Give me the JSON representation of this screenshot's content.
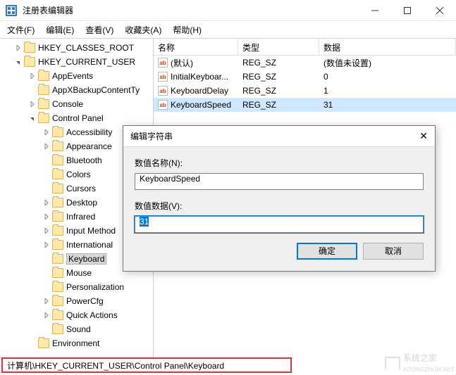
{
  "window": {
    "title": "注册表编辑器"
  },
  "menu": {
    "file": "文件(F)",
    "edit": "编辑(E)",
    "view": "查看(V)",
    "favorites": "收藏夹(A)",
    "help": "帮助(H)"
  },
  "tree": {
    "roots": [
      {
        "label": "HKEY_CLASSES_ROOT",
        "expanded": false,
        "indent": 20
      },
      {
        "label": "HKEY_CURRENT_USER",
        "expanded": true,
        "indent": 20
      }
    ],
    "hkcu_children": [
      {
        "label": "AppEvents",
        "indent": 40,
        "chev": true
      },
      {
        "label": "AppXBackupContentTy",
        "indent": 40,
        "chev": false
      },
      {
        "label": "Console",
        "indent": 40,
        "chev": true
      },
      {
        "label": "Control Panel",
        "indent": 40,
        "chev": true,
        "expanded": true
      }
    ],
    "cp_children": [
      {
        "label": "Accessibility",
        "indent": 60,
        "chev": true
      },
      {
        "label": "Appearance",
        "indent": 60,
        "chev": true
      },
      {
        "label": "Bluetooth",
        "indent": 60,
        "chev": false
      },
      {
        "label": "Colors",
        "indent": 60,
        "chev": false
      },
      {
        "label": "Cursors",
        "indent": 60,
        "chev": false
      },
      {
        "label": "Desktop",
        "indent": 60,
        "chev": true
      },
      {
        "label": "Infrared",
        "indent": 60,
        "chev": true
      },
      {
        "label": "Input Method",
        "indent": 60,
        "chev": true
      },
      {
        "label": "International",
        "indent": 60,
        "chev": true
      },
      {
        "label": "Keyboard",
        "indent": 60,
        "chev": false,
        "selected": true
      },
      {
        "label": "Mouse",
        "indent": 60,
        "chev": false
      },
      {
        "label": "Personalization",
        "indent": 60,
        "chev": false
      },
      {
        "label": "PowerCfg",
        "indent": 60,
        "chev": true
      },
      {
        "label": "Quick Actions",
        "indent": 60,
        "chev": true
      },
      {
        "label": "Sound",
        "indent": 60,
        "chev": false
      }
    ],
    "after": [
      {
        "label": "Environment",
        "indent": 40,
        "chev": false
      }
    ]
  },
  "list": {
    "headers": {
      "name": "名称",
      "type": "类型",
      "data": "数据"
    },
    "rows": [
      {
        "name": "(默认)",
        "type": "REG_SZ",
        "data": "(数值未设置)"
      },
      {
        "name": "InitialKeyboar...",
        "type": "REG_SZ",
        "data": "0"
      },
      {
        "name": "KeyboardDelay",
        "type": "REG_SZ",
        "data": "1"
      },
      {
        "name": "KeyboardSpeed",
        "type": "REG_SZ",
        "data": "31",
        "selected": true
      }
    ]
  },
  "dialog": {
    "title": "编辑字符串",
    "name_label": "数值名称(N):",
    "name_value": "KeyboardSpeed",
    "data_label": "数值数据(V):",
    "data_value": "31",
    "ok": "确定",
    "cancel": "取消"
  },
  "status": {
    "path": "计算机\\HKEY_CURRENT_USER\\Control Panel\\Keyboard"
  },
  "watermark": {
    "text": "系统之家",
    "url": "XITONGZHIJIA.NET"
  }
}
